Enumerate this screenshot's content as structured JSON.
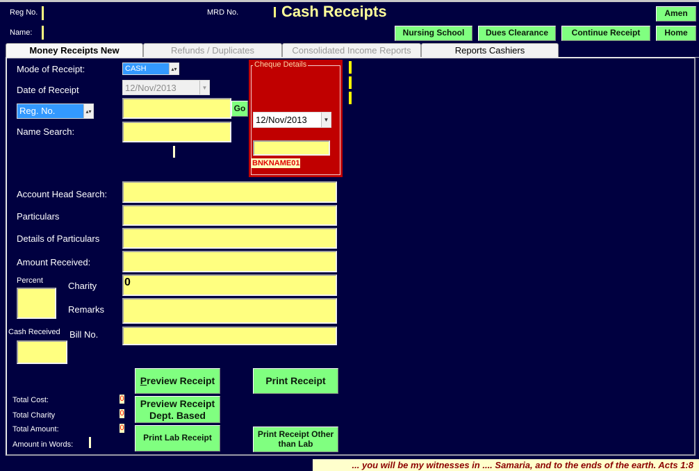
{
  "header": {
    "title": "Cash Receipts",
    "reg_no_label": "Reg No.",
    "name_label": "Name:",
    "mrd_no_label": "MRD No.",
    "buttons": {
      "amen": "Amen",
      "nursing_school": "Nursing School",
      "dues_clearance": "Dues Clearance",
      "continue_receipt": "Continue Receipt",
      "home": "Home"
    }
  },
  "tabs": [
    {
      "label": "Money Receipts New",
      "active": true
    },
    {
      "label": "Refunds / Duplicates",
      "active": false
    },
    {
      "label": "Consolidated Income Reports",
      "active": false
    },
    {
      "label": "Reports Cashiers",
      "active": false
    }
  ],
  "form": {
    "mode_of_receipt_label": "Mode of Receipt:",
    "mode_of_receipt_value": "CASH",
    "date_of_receipt_label": "Date of Receipt",
    "date_of_receipt_value": "12/Nov/2013",
    "search_type_value": "Reg. No.",
    "search_value": "",
    "go_label": "Go",
    "name_search_label": "Name Search:",
    "name_search_value": "",
    "account_head_label": "Account Head Search:",
    "account_head_value": "",
    "particulars_label": "Particulars",
    "particulars_value": "",
    "details_label": "Details of Particulars",
    "details_value": "",
    "amount_received_label": "Amount Received:",
    "amount_received_value": "",
    "percent_label": "Percent",
    "percent_value": "",
    "charity_label": "Charity",
    "charity_value": "0",
    "remarks_label": "Remarks",
    "remarks_value": "",
    "cash_received_label": "Cash Received",
    "cash_received_value": "",
    "bill_no_label": "Bill No.",
    "bill_no_value": ""
  },
  "cheque": {
    "legend": "Cheque Details",
    "date_value": "12/Nov/2013",
    "number_value": "",
    "bank_name": "BNKNAME01"
  },
  "totals": {
    "total_cost_label": "Total Cost:",
    "total_cost_value": "0",
    "total_charity_label": "Total Charity",
    "total_charity_value": "0",
    "total_amount_label": "Total Amount:",
    "total_amount_value": "0",
    "amount_in_words_label": "Amount in Words:"
  },
  "actions": {
    "preview_receipt_first": "P",
    "preview_receipt_rest": "review Receipt",
    "print_receipt": "Print Receipt",
    "preview_dept_line1": "Preview Receipt",
    "preview_dept_line2": "Dept. Based",
    "print_lab_receipt": "Print Lab Receipt",
    "print_other_line1": "Print Receipt Other",
    "print_other_line2": "than Lab"
  },
  "footer": {
    "verse": "... you will be my witnesses in .... Samaria, and to the ends of the earth.   Acts 1:8"
  }
}
